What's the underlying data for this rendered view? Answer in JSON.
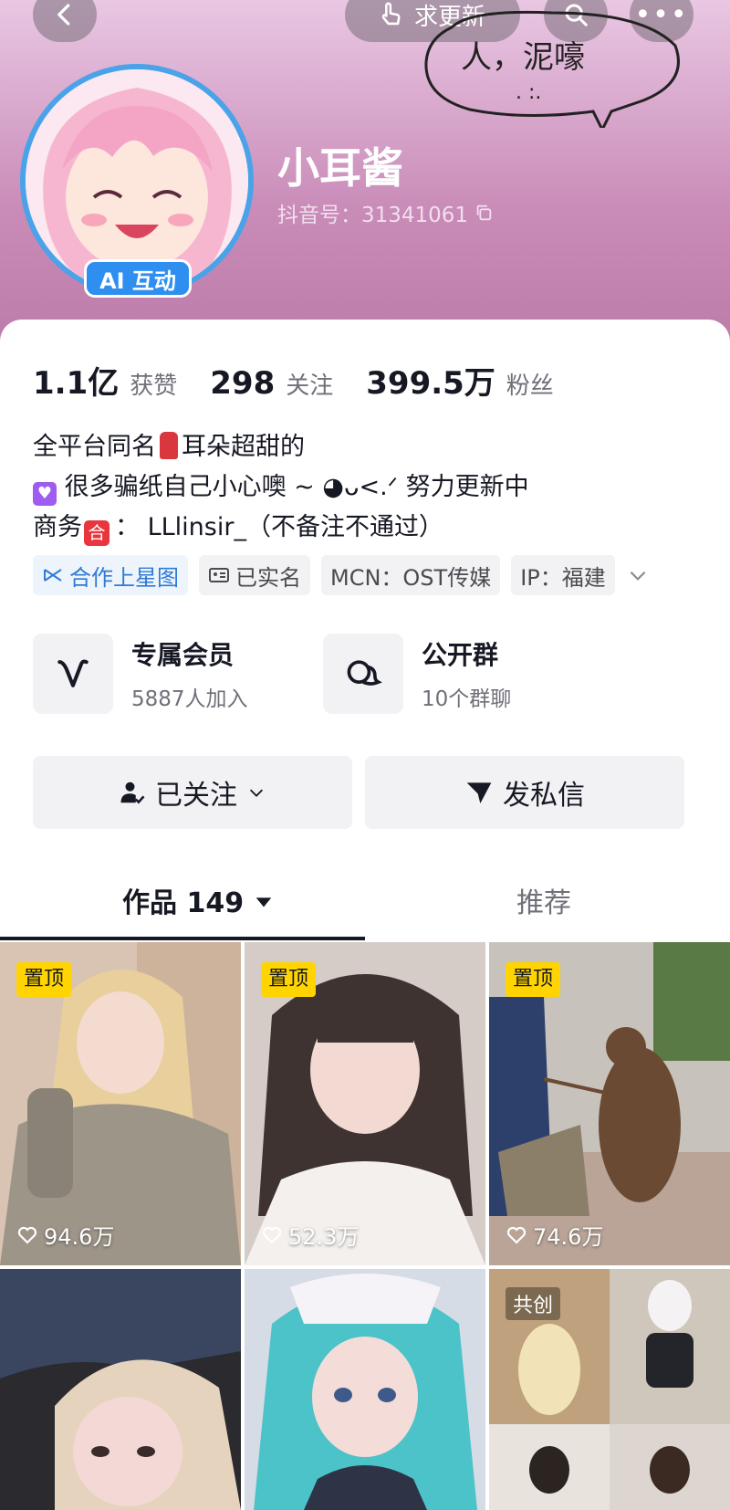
{
  "header": {
    "update_label": "求更新",
    "bubble_text": "人，泥嚎",
    "bubble_face": ". :."
  },
  "profile": {
    "name": "小耳酱",
    "douyin_id": "抖音号：31341061",
    "ai_badge": "AI 互动"
  },
  "stats": [
    {
      "value": "1.1亿",
      "label": "获赞"
    },
    {
      "value": "298",
      "label": "关注"
    },
    {
      "value": "399.5万",
      "label": "粉丝"
    }
  ],
  "bio": {
    "line1_a": "全平台同名",
    "line1_b": "耳朵超甜的",
    "line2": "很多骗纸自己小心噢 ~ ◕ᴗ<.ᐟ 努力更新中",
    "line3_a": "商务",
    "line3_he": "合",
    "line3_b": "：  LLlinsir_（不备注不通过）"
  },
  "tags": {
    "star_map": "合作上星图",
    "verified": "已实名",
    "mcn": "MCN：OST传媒",
    "ip": "IP：福建"
  },
  "features": {
    "member": {
      "title": "专属会员",
      "sub": "5887人加入"
    },
    "group": {
      "title": "公开群",
      "sub": "10个群聊"
    }
  },
  "actions": {
    "follow": "已关注",
    "message": "发私信"
  },
  "tabs": {
    "works": "作品 149",
    "recommend": "推荐"
  },
  "videos": [
    {
      "pinned": "置顶",
      "likes": "94.6万"
    },
    {
      "pinned": "置顶",
      "likes": "52.3万"
    },
    {
      "pinned": "置顶",
      "likes": "74.6万"
    },
    {
      "collab": "共创"
    }
  ],
  "colors": {
    "header_top": "#e9c7e3",
    "header_bottom": "#b978a6",
    "pin_badge": "#ffd400",
    "ai_badge": "#2f8ff0",
    "star_map": "#2e7bd6"
  }
}
